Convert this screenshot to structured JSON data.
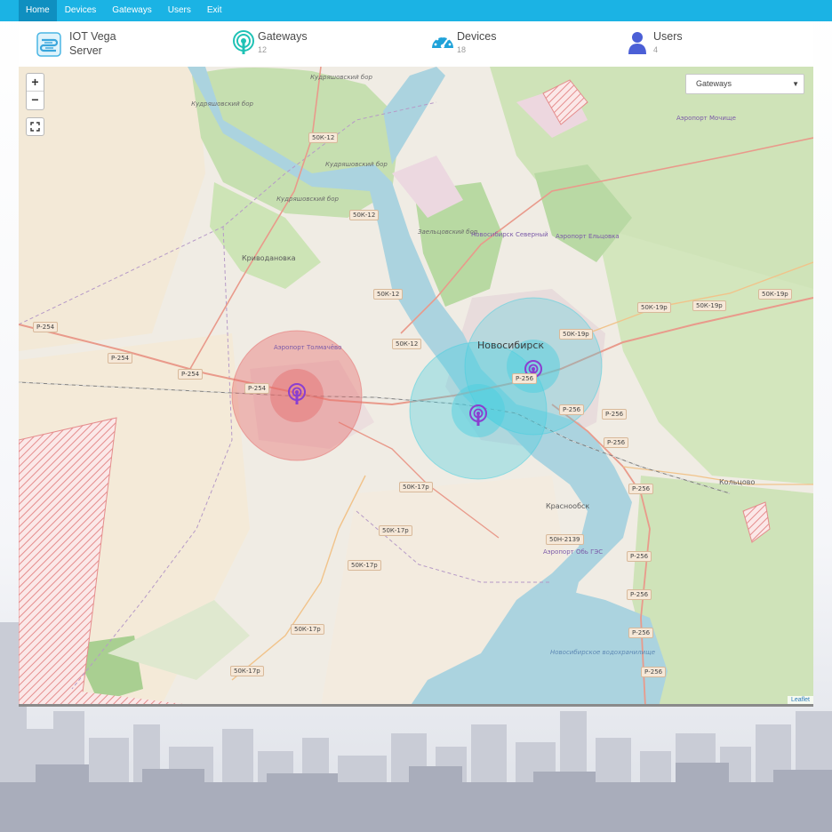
{
  "nav": {
    "items": [
      {
        "label": "Home",
        "active": true
      },
      {
        "label": "Devices",
        "active": false
      },
      {
        "label": "Gateways",
        "active": false
      },
      {
        "label": "Users",
        "active": false
      },
      {
        "label": "Exit",
        "active": false
      }
    ]
  },
  "header": {
    "logo_line1": "IOT Vega",
    "logo_line2": "Server",
    "gateways": {
      "title": "Gateways",
      "count": "12",
      "icon": "gateway-icon"
    },
    "devices": {
      "title": "Devices",
      "count": "18",
      "icon": "speedometer-icon"
    },
    "users": {
      "title": "Users",
      "count": "4",
      "icon": "user-icon"
    }
  },
  "colors": {
    "navbar": "#1bb3e4",
    "nav_active": "#0f8fc0",
    "gateway_icon": "#1fc2b5",
    "devices_icon": "#1ea2d9",
    "users_icon": "#4b5fd6",
    "marker": "#8a3fd0",
    "coverage_red": "#e56a6a",
    "coverage_cyan": "#46cfe0"
  },
  "map": {
    "layer_select": {
      "value": "Gateways"
    },
    "attribution": "Leaflet",
    "zoom_in": "+",
    "zoom_out": "−",
    "labels": {
      "city_main": "Новосибирск",
      "krivodanovka": "Криводановка",
      "krasnoobsk": "Краснообск",
      "koltsovo": "Кольцово",
      "forest1": "Кудряшовский бор",
      "forest2": "Кудряшовский бор",
      "forest3": "Кудряшовский бор",
      "forest4": "Кудряшовский бор",
      "forest5": "Заельцовский бор",
      "airport1": "Аэропорт Толмачёво",
      "airport2": "Аэропорт Мочище",
      "airport3": "Аэропорт Ельцовка",
      "airport4": "Аэропорт Обь ГЭС",
      "airport5": "Новосибирск Северный",
      "reservoir": "Новосибирское водохранилище"
    },
    "roads": [
      "50К-12",
      "50К-12",
      "50К-12",
      "50К-12",
      "Р-254",
      "Р-254",
      "Р-254",
      "Р-254",
      "50К-19р",
      "50К-19р",
      "50К-19р",
      "50К-19р",
      "Р-256",
      "Р-256",
      "Р-256",
      "Р-256",
      "Р-256",
      "Р-256",
      "Р-256",
      "Р-256",
      "50К-17р",
      "50К-17р",
      "50К-17р",
      "50К-17р",
      "50К-17р",
      "50Н-2139",
      "Р-256"
    ]
  }
}
